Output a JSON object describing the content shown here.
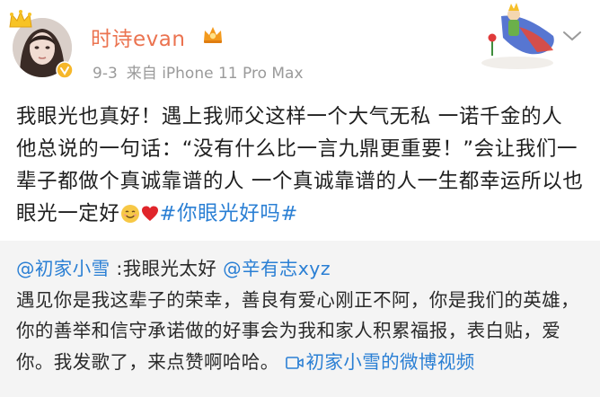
{
  "post": {
    "username": "时诗evan",
    "date": "9-3",
    "source_prefix": "来自",
    "device": "iPhone 11 Pro Max",
    "text_before_tag": "我眼光也真好！遇上我师父这样一个大气无私 一诺千金的人 他总说的一句话：“没有什么比一言九鼎更重要！”会让我们一辈子都做个真诚靠谱的人 一个真诚靠谱的人一生都幸运所以也眼光一定好",
    "hashtag": "#你眼光好吗#",
    "emojis": [
      "smile-emoji",
      "red-heart-emoji"
    ]
  },
  "repost": {
    "author_mention": "@初家小雪",
    "author_text": ":我眼光太好",
    "mention": "@辛有志xyz",
    "body": "遇见你是我这辈子的荣幸，善良有爱心刚正不阿，你是我们的英雄，你的善举和信守承诺做的好事会为我和家人积累福报，表白贴，爱你。我发歌了，来点赞啊哈哈。",
    "video_link": "初家小雪的微博视频"
  },
  "icons": {
    "avatar": "avatar",
    "crown": "crown-icon",
    "verified": "verified-badge-icon",
    "vip": "vip-crown-icon",
    "decoration": "little-prince-decoration",
    "more": "chevron-down-icon",
    "video": "video-icon"
  },
  "colors": {
    "username": "#eb7350",
    "link": "#2a7fd4",
    "meta": "#9a9a9a",
    "repost_bg": "#f4f4f4"
  }
}
